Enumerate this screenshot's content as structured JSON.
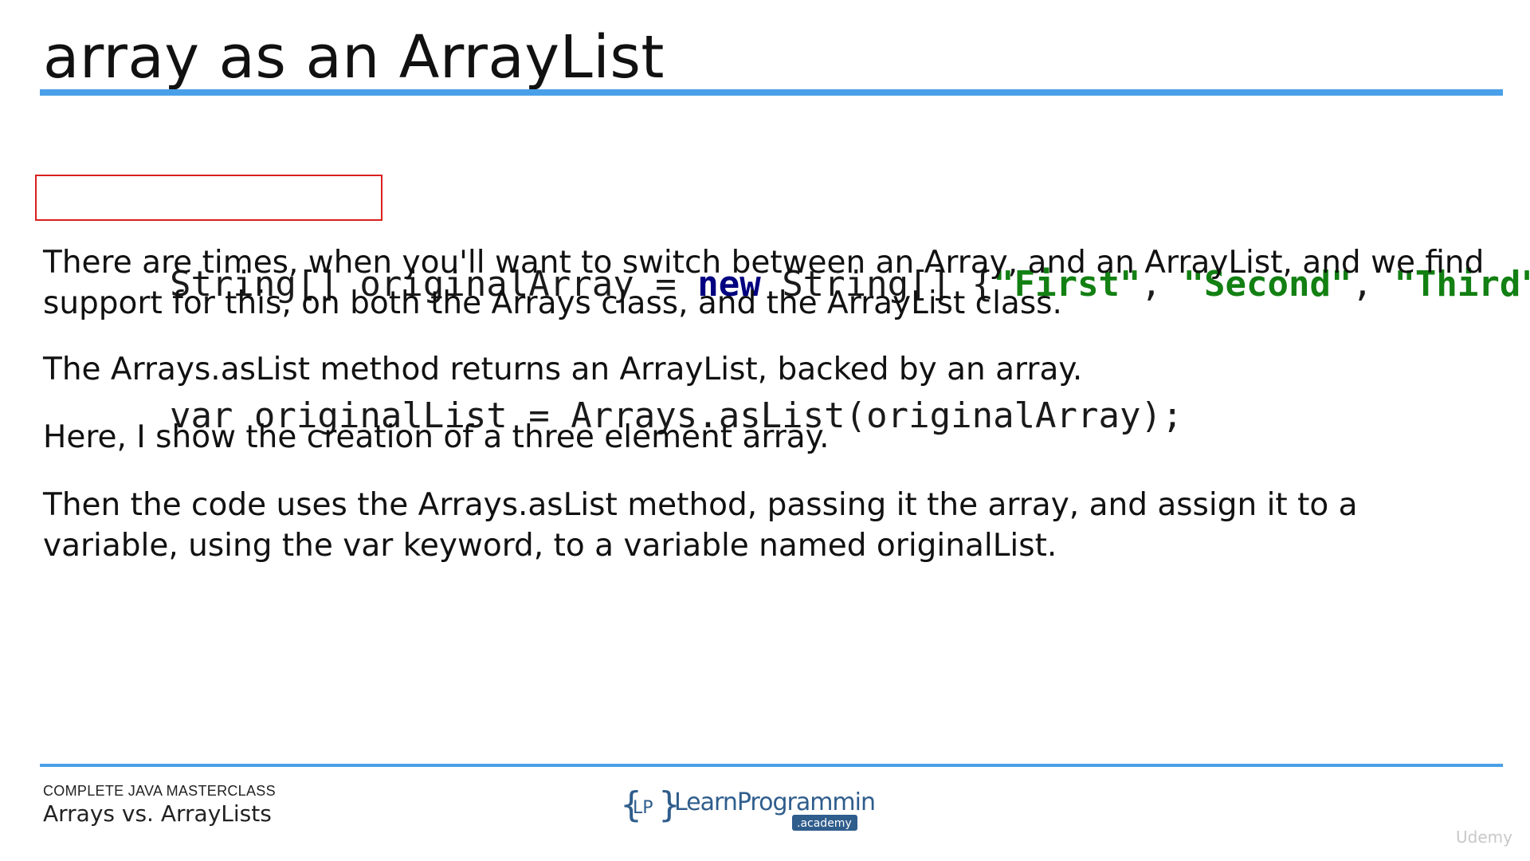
{
  "slide": {
    "title": "array as an ArrayList",
    "code": {
      "line1": [
        {
          "t": "String[] originalArray = ",
          "cls": ""
        },
        {
          "t": "new",
          "cls": "kw"
        },
        {
          "t": " String[] {",
          "cls": ""
        },
        {
          "t": "\"First\"",
          "cls": "str"
        },
        {
          "t": ", ",
          "cls": ""
        },
        {
          "t": "\"Second\"",
          "cls": "str"
        },
        {
          "t": ", ",
          "cls": ""
        },
        {
          "t": "\"Third\"",
          "cls": "str"
        },
        {
          "t": "};",
          "cls": ""
        }
      ],
      "line2": [
        {
          "t": "var originalList",
          "cls": ""
        },
        {
          "t": " = Arrays.asList(originalArray);",
          "cls": ""
        }
      ]
    },
    "paragraphs": [
      "There are times, when you'll want to switch between an Array, and an ArrayList, and we find support for this, on both the Arrays class, and the ArrayList class.",
      "The Arrays.asList method returns an ArrayList, backed by an array.",
      "Here, I show the creation of a three element array.",
      "Then the code uses the Arrays.asList method, passing it the array, and assign it to a variable, using the var keyword, to a variable named originalList."
    ]
  },
  "footer": {
    "course": "COMPLETE JAVA MASTERCLASS",
    "subtitle": "Arrays vs. ArrayLists",
    "logo_main": "LearnProgramming",
    "logo_badge": ".academy",
    "logo_mark": "LP",
    "watermark": "Udemy"
  },
  "colors": {
    "accent_rule": "#4aa0e8",
    "keyword": "#000080",
    "string_literal": "#128012",
    "highlight_box": "#d9201f",
    "logo_badge": "#2f5d8c"
  },
  "icons": [
    "learnprogramming-logo",
    "udemy-watermark"
  ]
}
